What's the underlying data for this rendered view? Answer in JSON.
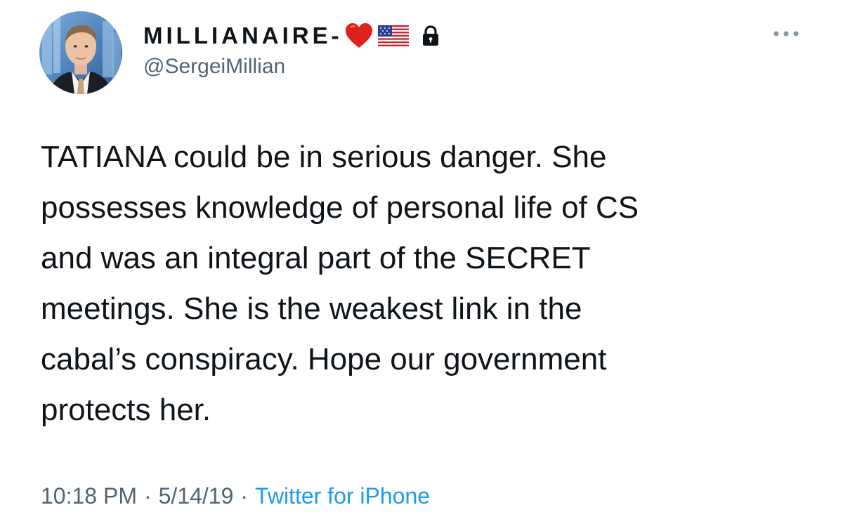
{
  "tweet": {
    "author": {
      "display_name": "MILLIANAIRE-",
      "handle": "@SergeiMillian",
      "badges": [
        "heart-icon",
        "us-flag-icon",
        "lock-icon"
      ],
      "avatar": "profile-photo"
    },
    "text": "TATIANA could be in serious danger. She\npossesses knowledge of personal life of CS\nand was an integral part of the SECRET\nmeetings. She is the weakest link in the\ncabal’s conspiracy. Hope our government\nprotects her.",
    "time": "10:18 PM",
    "date": "5/14/19",
    "separator": "·",
    "source": "Twitter for iPhone",
    "menu_icon": "more-options-icon"
  },
  "colors": {
    "text_primary": "#0f1419",
    "text_secondary": "#536471",
    "link": "#1d9bf0",
    "heart": "#e0201b"
  }
}
